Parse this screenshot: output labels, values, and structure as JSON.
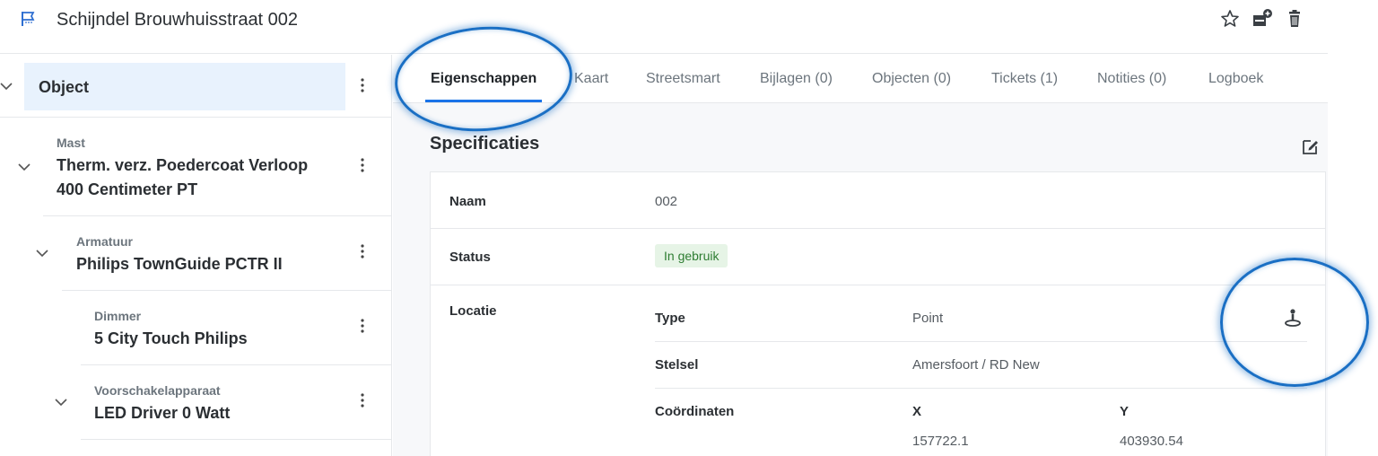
{
  "header": {
    "title": "Schijndel Brouwhuisstraat 002",
    "icons": {
      "app": "flag-icon",
      "favorite": "star-icon",
      "add": "inbox-plus-icon",
      "delete": "trash-icon"
    }
  },
  "sidebar": {
    "root_label": "Object",
    "items": [
      {
        "kind": "Mast",
        "name_line1": "Therm. verz. Poedercoat Verloop",
        "name_line2": "400 Centimeter PT"
      },
      {
        "kind": "Armatuur",
        "name_line1": "Philips TownGuide PCTR II",
        "name_line2": ""
      },
      {
        "kind": "Dimmer",
        "name_line1": "5 City Touch Philips",
        "name_line2": ""
      },
      {
        "kind": "Voorschakelapparaat",
        "name_line1": "LED Driver 0 Watt",
        "name_line2": ""
      }
    ]
  },
  "tabs": [
    {
      "label": "Eigenschappen"
    },
    {
      "label": "Kaart"
    },
    {
      "label": "Streetsmart"
    },
    {
      "label": "Bijlagen (0)"
    },
    {
      "label": "Objecten (0)"
    },
    {
      "label": "Tickets (1)"
    },
    {
      "label": "Notities (0)"
    },
    {
      "label": "Logboek"
    }
  ],
  "specs": {
    "title": "Specificaties",
    "naam_label": "Naam",
    "naam_value": "002",
    "status_label": "Status",
    "status_value": "In gebruik",
    "locatie_label": "Locatie",
    "type_label": "Type",
    "type_value": "Point",
    "stelsel_label": "Stelsel",
    "stelsel_value": "Amersfoort / RD New",
    "coord_label": "Coördinaten",
    "x_label": "X",
    "y_label": "Y",
    "x_value": "157722.1",
    "y_value": "403930.54"
  },
  "colors": {
    "accent": "#1a73e8",
    "selected_bg": "#e8f2fd",
    "badge_bg": "#e6f4e6",
    "badge_text": "#2e7d32",
    "highlight_ring": "#1a6fc4"
  }
}
